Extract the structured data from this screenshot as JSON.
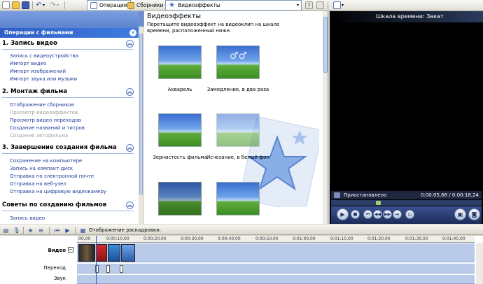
{
  "toolbar": {
    "tasks_label": "Операции",
    "collections_label": "Сборники",
    "collection_select": "Видеоэффекты"
  },
  "taskpane": {
    "header": "Операции с фильмами",
    "sections": [
      {
        "title": "1. Запись видео",
        "links": [
          "Запись с видеоустройства",
          "Импорт видео",
          "Импорт изображений",
          "Импорт звука или музыки"
        ]
      },
      {
        "title": "2. Монтаж фильма",
        "links": [
          "Отображение сборников",
          "Просмотр видеоэффектов",
          "Просмотр видео переходов",
          "Создание названий и титров",
          "Создание автофильма"
        ]
      },
      {
        "title": "3. Завершение создания фильма",
        "links": [
          "Сохранение на компьютере",
          "Запись на компакт-диск",
          "Отправка по электронной почте",
          "Отправка на веб-узел",
          "Отправка на цифровую видеокамеру"
        ]
      },
      {
        "title": "Советы по созданию фильмов",
        "links": [
          "Запись видео"
        ]
      }
    ]
  },
  "center": {
    "title": "Видеоэффекты",
    "description": "Перетащите видеоэффект на видеоклип на шкале времени, расположенный ниже.",
    "effects": [
      "Акварель",
      "Замедление, в два раза",
      "Зернистость фильма",
      "Исчезание, в белый фон"
    ]
  },
  "preview": {
    "title": "Шкала времени: Закат",
    "status": "Приостановлено",
    "time": "0:00:05,68 / 0:00:18,24",
    "seek_position": 0.31
  },
  "timeline": {
    "mode_label": "Отображение раскадровки.",
    "ticks": [
      "00,00",
      "0:00:10,00",
      "0:00:20,00",
      "0:00:30,00",
      "0:00:40,00",
      "0:00:50,00",
      "0:01:00,00",
      "0:01:10,00",
      "0:01:20,00",
      "0:01:30,00",
      "0:01:40,00"
    ],
    "tracks": [
      "Видео",
      "Переход",
      "Звук"
    ]
  },
  "colors": {
    "taskpane_blue": "#6b8fd6",
    "link_blue": "#1f3b9a",
    "timeline_track": "#b9cbe8"
  }
}
